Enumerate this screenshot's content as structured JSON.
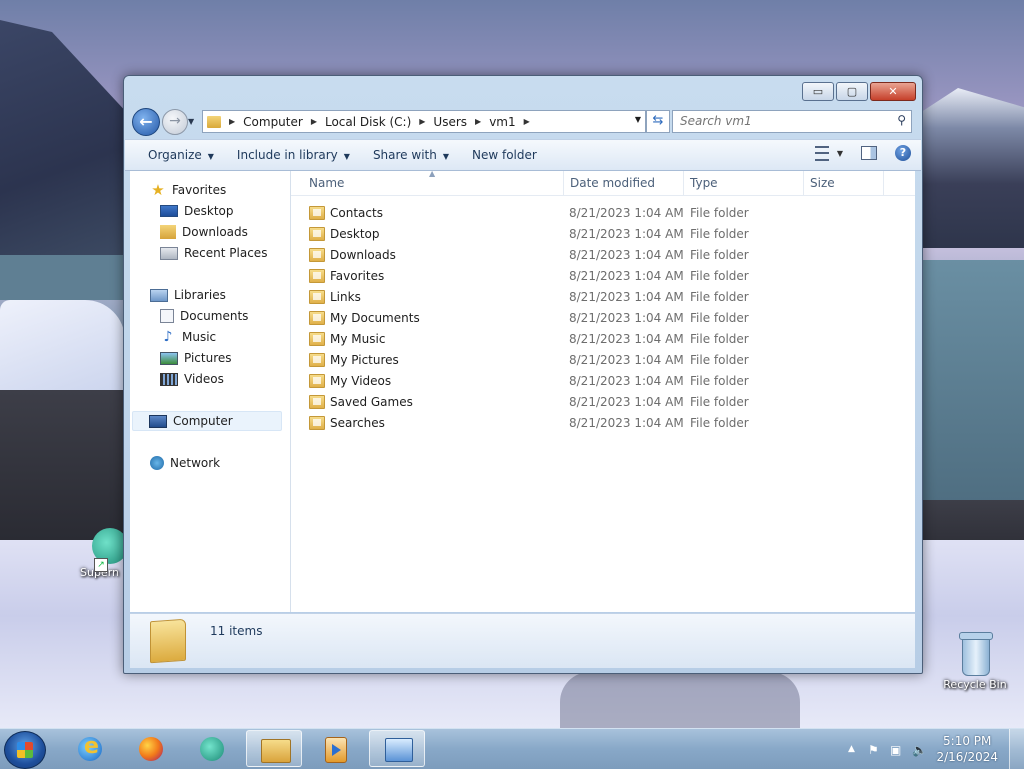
{
  "desktop": {
    "icons": [
      {
        "label": "Recycle Bin"
      },
      {
        "label": "Supern"
      }
    ]
  },
  "window": {
    "buttons": {
      "minimize": "▭",
      "maximize": "▢",
      "close": "✕"
    },
    "address": {
      "crumbs": [
        "Computer",
        "Local Disk (C:)",
        "Users",
        "vm1"
      ]
    },
    "search": {
      "placeholder": "Search vm1"
    },
    "toolbar": {
      "organize": "Organize",
      "include_in_library": "Include in library",
      "share_with": "Share with",
      "new_folder": "New folder"
    },
    "nav": {
      "favorites": "Favorites",
      "desktop": "Desktop",
      "downloads": "Downloads",
      "recent_places": "Recent Places",
      "libraries": "Libraries",
      "documents": "Documents",
      "music": "Music",
      "pictures": "Pictures",
      "videos": "Videos",
      "computer": "Computer",
      "network": "Network"
    },
    "columns": {
      "name": "Name",
      "date_modified": "Date modified",
      "type": "Type",
      "size": "Size"
    },
    "files": [
      {
        "name": "Contacts",
        "date": "8/21/2023 1:04 AM",
        "type": "File folder"
      },
      {
        "name": "Desktop",
        "date": "8/21/2023 1:04 AM",
        "type": "File folder"
      },
      {
        "name": "Downloads",
        "date": "8/21/2023 1:04 AM",
        "type": "File folder"
      },
      {
        "name": "Favorites",
        "date": "8/21/2023 1:04 AM",
        "type": "File folder"
      },
      {
        "name": "Links",
        "date": "8/21/2023 1:04 AM",
        "type": "File folder"
      },
      {
        "name": "My Documents",
        "date": "8/21/2023 1:04 AM",
        "type": "File folder"
      },
      {
        "name": "My Music",
        "date": "8/21/2023 1:04 AM",
        "type": "File folder"
      },
      {
        "name": "My Pictures",
        "date": "8/21/2023 1:04 AM",
        "type": "File folder"
      },
      {
        "name": "My Videos",
        "date": "8/21/2023 1:04 AM",
        "type": "File folder"
      },
      {
        "name": "Saved Games",
        "date": "8/21/2023 1:04 AM",
        "type": "File folder"
      },
      {
        "name": "Searches",
        "date": "8/21/2023 1:04 AM",
        "type": "File folder"
      }
    ],
    "status": {
      "item_count": "11 items"
    }
  },
  "taskbar": {
    "apps": [
      "internet-explorer-icon",
      "firefox-icon",
      "superhuman-icon",
      "windows-explorer-icon",
      "windows-media-player-icon",
      "remote-desktop-icon"
    ],
    "clock": {
      "time": "5:10 PM",
      "date": "2/16/2024"
    }
  }
}
